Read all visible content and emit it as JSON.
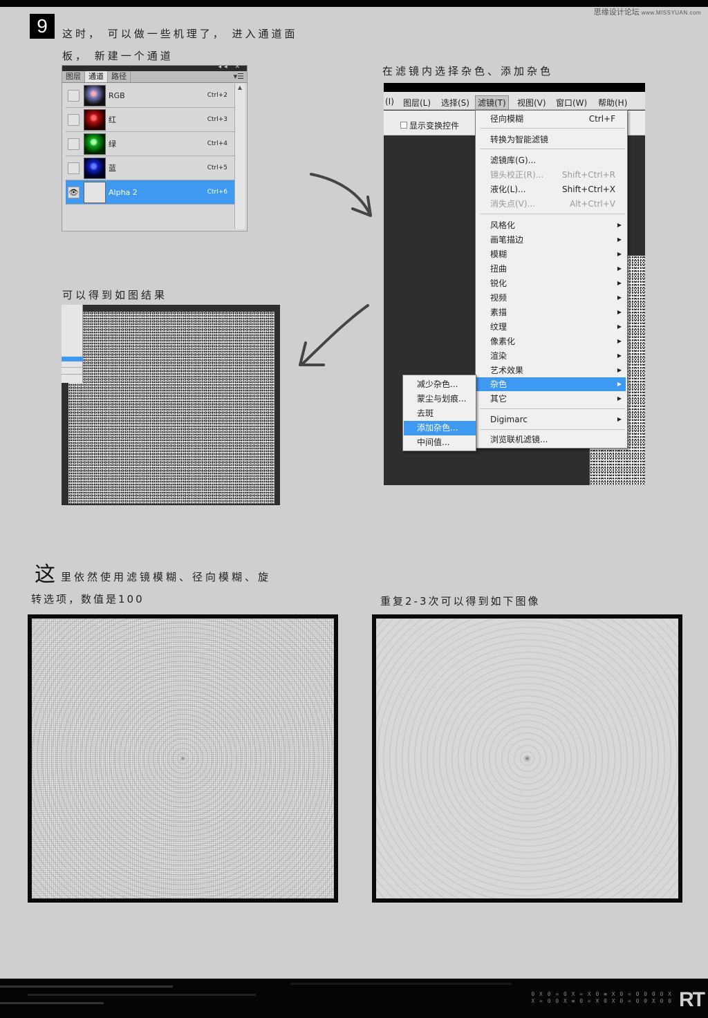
{
  "watermark": {
    "site": "思缘设计论坛",
    "url": "www.MISSYUAN.com"
  },
  "step": {
    "number": "9"
  },
  "texts": {
    "intro_line1": "这时， 可以做一些机理了， 进入通道面",
    "intro_line2": "板， 新建一个通道",
    "filter_caption": "在滤镜内选择杂色、添加杂色",
    "result_caption": "可以得到如图结果",
    "blur_big_char": "这",
    "blur_line1": "里依然使用滤镜模糊、径向模糊、旋",
    "blur_line2": "转选项，数值是100",
    "repeat_caption": "重复2-3次可以得到如下图像"
  },
  "channels_panel": {
    "tabs": [
      "图层",
      "通道",
      "路径"
    ],
    "active_tab": "通道",
    "rows": [
      {
        "name": "RGB",
        "shortcut": "Ctrl+2",
        "color": "#6a6aa0"
      },
      {
        "name": "红",
        "shortcut": "Ctrl+3",
        "color": "#b01010"
      },
      {
        "name": "绿",
        "shortcut": "Ctrl+4",
        "color": "#10a020"
      },
      {
        "name": "蓝",
        "shortcut": "Ctrl+5",
        "color": "#1020c0"
      },
      {
        "name": "Alpha 2",
        "shortcut": "Ctrl+6",
        "color": "#e0e0e0"
      }
    ]
  },
  "menubar": {
    "items": [
      "(I)",
      "图层(L)",
      "选择(S)",
      "滤镜(T)",
      "视图(V)",
      "窗口(W)",
      "帮助(H)"
    ],
    "active": "滤镜(T)",
    "option_label": "显示变换控件"
  },
  "filter_menu": {
    "items": [
      {
        "label": "径向模糊",
        "shortcut": "Ctrl+F"
      },
      {
        "label": "转换为智能滤镜"
      },
      {
        "label": "滤镜库(G)..."
      },
      {
        "label": "镜头校正(R)...",
        "shortcut": "Shift+Ctrl+R"
      },
      {
        "label": "液化(L)...",
        "shortcut": "Shift+Ctrl+X"
      },
      {
        "label": "消失点(V)...",
        "shortcut": "Alt+Ctrl+V"
      },
      {
        "label": "风格化"
      },
      {
        "label": "画笔描边"
      },
      {
        "label": "模糊"
      },
      {
        "label": "扭曲"
      },
      {
        "label": "锐化"
      },
      {
        "label": "视频"
      },
      {
        "label": "素描"
      },
      {
        "label": "纹理"
      },
      {
        "label": "像素化"
      },
      {
        "label": "渲染"
      },
      {
        "label": "艺术效果"
      },
      {
        "label": "杂色"
      },
      {
        "label": "其它"
      },
      {
        "label": "Digimarc"
      },
      {
        "label": "浏览联机滤镜..."
      }
    ]
  },
  "noise_submenu": {
    "items": [
      "减少杂色...",
      "蒙尘与划痕...",
      "去斑",
      "添加杂色...",
      "中间值..."
    ]
  },
  "footer": {
    "code_line1": "0 X 0 = 0 X = X 0 ≡ X 0 = 0 0 0 0 X",
    "code_line2": "X = 0 0 X ≡ 0 = X 0 X 0 = 0 0 X 0 0",
    "logo": "RT"
  }
}
